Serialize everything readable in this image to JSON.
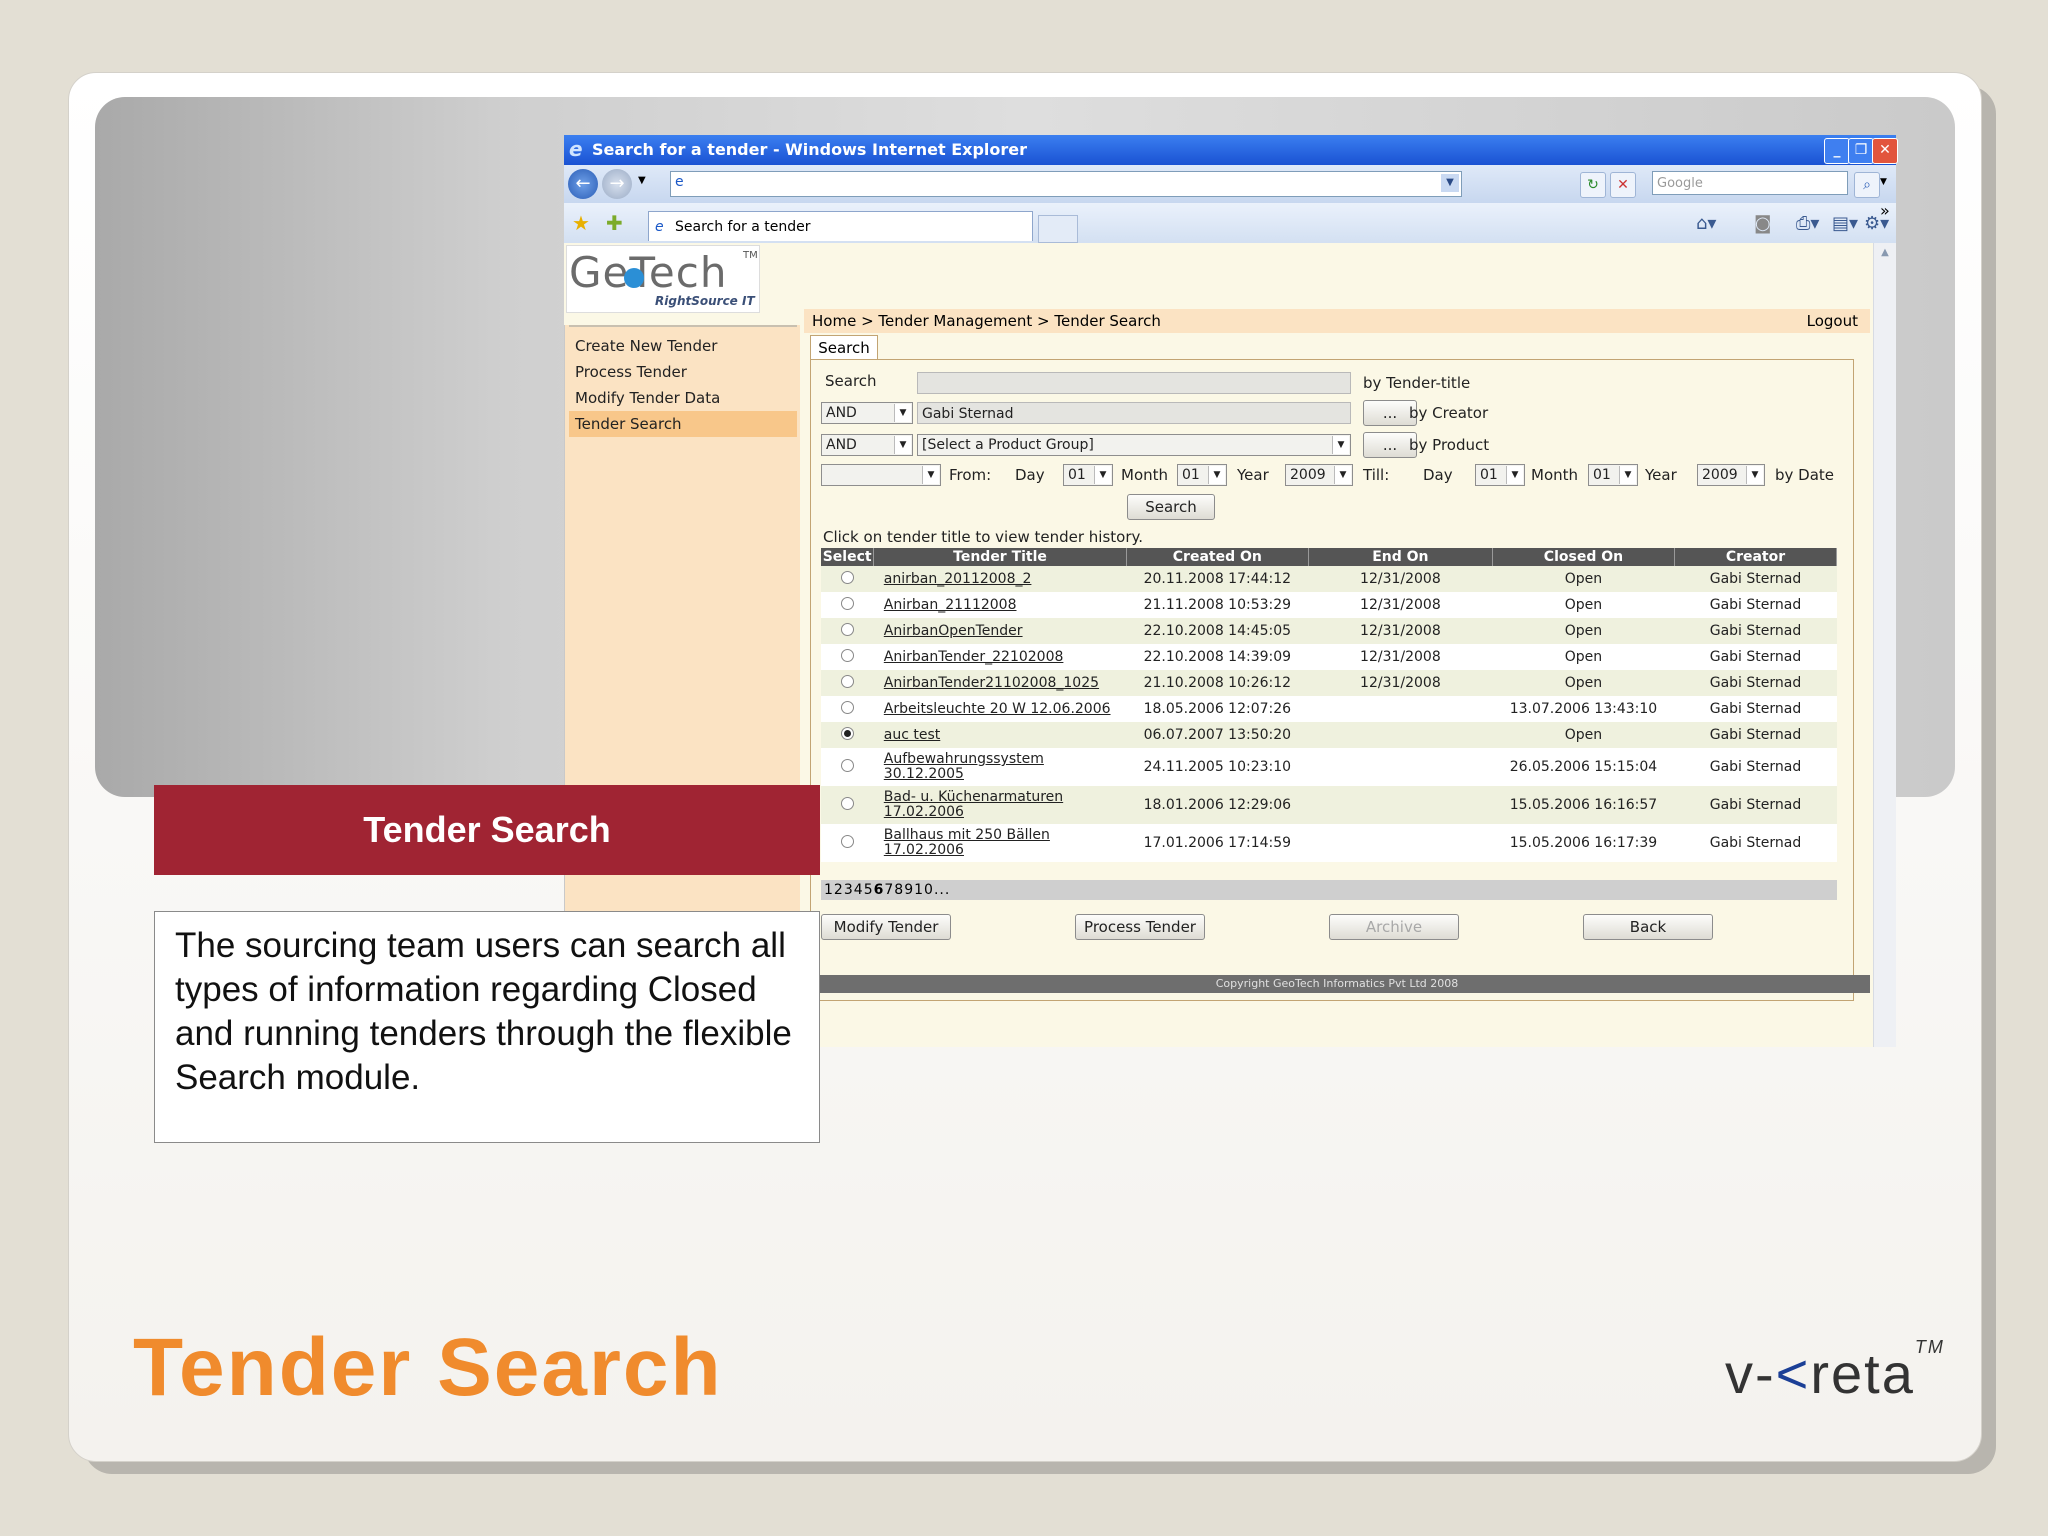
{
  "slide": {
    "heading": "Tender Search",
    "banner": "Tender Search",
    "description": "The sourcing team users can search all types of information regarding Closed and running tenders through the flexible Search module.",
    "brand": "v-kreta",
    "brand_prefix": "v-",
    "brand_k": "<",
    "brand_rest": "reta",
    "brand_tm": "TM",
    "accent_color": "#f08b2d",
    "banner_color": "#a02433"
  },
  "browser": {
    "title": "Search for a tender - Windows Internet Explorer",
    "tab_label": "Search for a tender",
    "search_placeholder": "Google",
    "chevrons": "»"
  },
  "site": {
    "logo_text": "GeTech",
    "logo_tm": "TM",
    "logo_tagline": "RightSource IT",
    "breadcrumb": "Home > Tender Management > Tender Search",
    "logout": "Logout",
    "nav": [
      "Create New Tender",
      "Process Tender",
      "Modify Tender Data",
      "Tender Search"
    ],
    "footer": "Copyright GeoTech Informatics Pvt Ltd 2008"
  },
  "search": {
    "tab": "Search",
    "search_label": "Search",
    "title_value": "",
    "by_title": "by Tender-title",
    "op1": "AND",
    "creator_value": "Gabi Sternad",
    "by_creator": "by Creator",
    "op2": "AND",
    "product_value": "[Select a Product Group]",
    "by_product": "by Product",
    "ellipsis": "...",
    "from_label": "From:",
    "till_label": "Till:",
    "day_label": "Day",
    "month_label": "Month",
    "year_label": "Year",
    "from_day": "01",
    "from_month": "01",
    "from_year": "2009",
    "till_day": "01",
    "till_month": "01",
    "till_year": "2009",
    "by_date": "by Date",
    "search_button": "Search",
    "hint": "Click on tender title to view tender history."
  },
  "table": {
    "headers": [
      "Select",
      "Tender Title",
      "Created On",
      "End On",
      "Closed On",
      "Creator"
    ],
    "rows": [
      {
        "title": "anirban_20112008_2",
        "created": "20.11.2008 17:44:12",
        "end": "12/31/2008",
        "closed": "Open",
        "creator": "Gabi Sternad",
        "selected": false
      },
      {
        "title": "Anirban_21112008",
        "created": "21.11.2008 10:53:29",
        "end": "12/31/2008",
        "closed": "Open",
        "creator": "Gabi Sternad",
        "selected": false
      },
      {
        "title": "AnirbanOpenTender",
        "created": "22.10.2008 14:45:05",
        "end": "12/31/2008",
        "closed": "Open",
        "creator": "Gabi Sternad",
        "selected": false
      },
      {
        "title": "AnirbanTender_22102008",
        "created": "22.10.2008 14:39:09",
        "end": "12/31/2008",
        "closed": "Open",
        "creator": "Gabi Sternad",
        "selected": false
      },
      {
        "title": "AnirbanTender21102008_1025",
        "created": "21.10.2008 10:26:12",
        "end": "12/31/2008",
        "closed": "Open",
        "creator": "Gabi Sternad",
        "selected": false
      },
      {
        "title": "Arbeitsleuchte 20 W 12.06.2006",
        "created": "18.05.2006 12:07:26",
        "end": "",
        "closed": "13.07.2006 13:43:10",
        "creator": "Gabi Sternad",
        "selected": false
      },
      {
        "title": "auc test",
        "created": "06.07.2007 13:50:20",
        "end": "",
        "closed": "Open",
        "creator": "Gabi Sternad",
        "selected": true
      },
      {
        "title": "Aufbewahrungssystem 30.12.2005",
        "created": "24.11.2005 10:23:10",
        "end": "",
        "closed": "26.05.2006 15:15:04",
        "creator": "Gabi Sternad",
        "selected": false
      },
      {
        "title": "Bad- u. Küchenarmaturen 17.02.2006",
        "created": "18.01.2006 12:29:06",
        "end": "",
        "closed": "15.05.2006 16:16:57",
        "creator": "Gabi Sternad",
        "selected": false
      },
      {
        "title": "Ballhaus mit 250 Bällen 17.02.2006",
        "created": "17.01.2006 17:14:59",
        "end": "",
        "closed": "15.05.2006 16:17:39",
        "creator": "Gabi Sternad",
        "selected": false
      }
    ],
    "pager_pages": [
      "1",
      "2",
      "3",
      "4",
      "5",
      "6",
      "7",
      "8",
      "9",
      "10",
      "..."
    ],
    "pager_current": "6"
  },
  "actions": {
    "modify": "Modify Tender",
    "process": "Process Tender",
    "archive": "Archive",
    "back": "Back"
  }
}
